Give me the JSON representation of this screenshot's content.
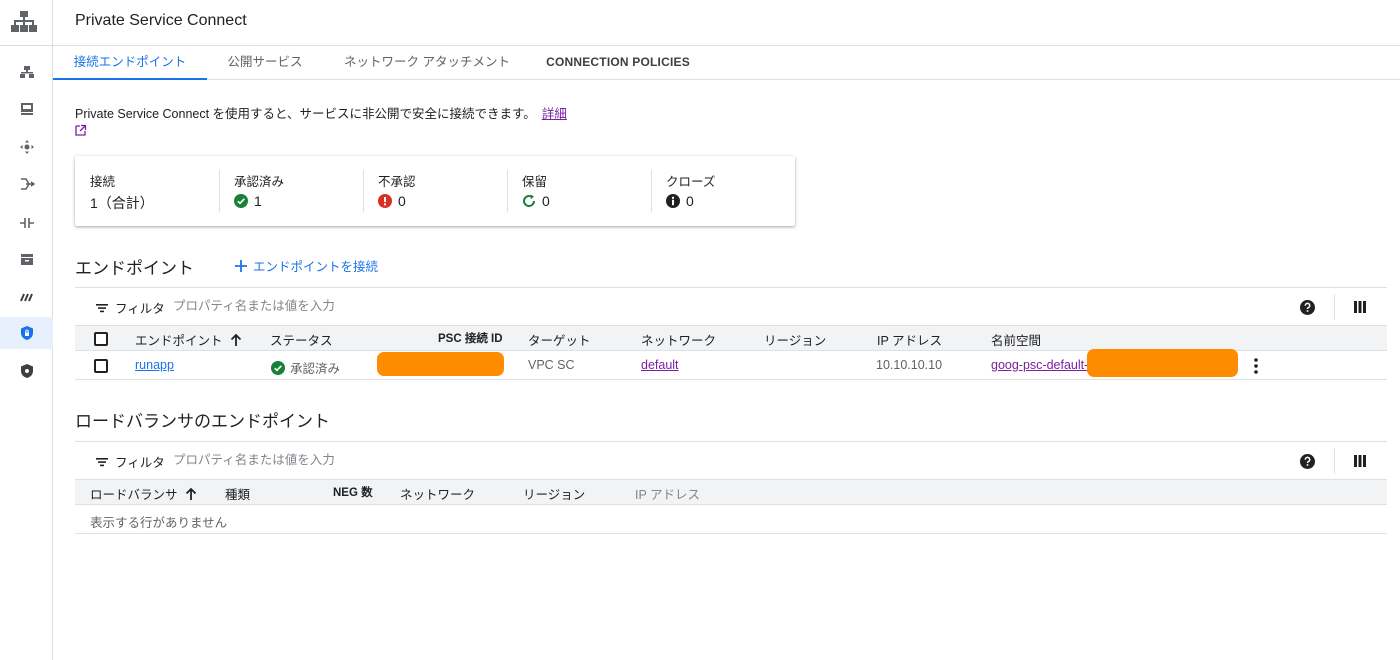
{
  "page": {
    "title": "Private Service Connect"
  },
  "rail": {
    "items": [
      {
        "icon": "network-topology-icon"
      },
      {
        "icon": "vm-instance-icon"
      },
      {
        "icon": "routes-icon"
      },
      {
        "icon": "load-balancing-icon"
      },
      {
        "icon": "interconnect-icon"
      },
      {
        "icon": "storage-icon"
      },
      {
        "icon": "network-services-icon"
      },
      {
        "icon": "private-service-connect-icon",
        "active": true
      },
      {
        "icon": "security-shield-icon"
      }
    ]
  },
  "tabs": [
    {
      "label": "接続エンドポイント",
      "active": true
    },
    {
      "label": "公開サービス"
    },
    {
      "label": "ネットワーク アタッチメント"
    },
    {
      "label": "CONNECTION POLICIES"
    }
  ],
  "description": {
    "text": "Private Service Connect を使用すると、サービスに非公開で安全に接続できます。",
    "link": "詳細"
  },
  "summary": [
    {
      "label": "接続",
      "value": "1（合計）",
      "icon": ""
    },
    {
      "label": "承認済み",
      "value": "1",
      "icon": "check-circle-icon",
      "color": "#188038"
    },
    {
      "label": "不承認",
      "value": "0",
      "icon": "error-icon",
      "color": "#d93025"
    },
    {
      "label": "保留",
      "value": "0",
      "icon": "pending-icon",
      "color": "#188038"
    },
    {
      "label": "クローズ",
      "value": "0",
      "icon": "info-icon",
      "color": "#202124"
    }
  ],
  "endpoints": {
    "title": "エンドポイント",
    "add_label": "エンドポイントを接続",
    "filter_label": "フィルタ",
    "filter_placeholder": "プロパティ名または値を入力",
    "columns": [
      "エンドポイント",
      "ステータス",
      "PSC 接続 ID",
      "ターゲット",
      "ネットワーク",
      "リージョン",
      "IP アドレス",
      "名前空間"
    ],
    "rows": [
      {
        "name": "runapp",
        "status": "承認済み",
        "psc_id": "",
        "target": "VPC SC",
        "network": "default",
        "region": "",
        "ip": "10.10.10.10",
        "namespace": "goog-psc-default-"
      }
    ]
  },
  "lb_endpoints": {
    "title": "ロードバランサのエンドポイント",
    "filter_label": "フィルタ",
    "filter_placeholder": "プロパティ名または値を入力",
    "columns": [
      "ロードバランサ",
      "種類",
      "NEG 数",
      "ネットワーク",
      "リージョン",
      "IP アドレス"
    ],
    "empty_text": "表示する行がありません"
  },
  "colors": {
    "accent": "#1a73e8",
    "link_purple": "#7b1fa2",
    "success": "#188038",
    "error": "#d93025",
    "redaction": "#ff8c00"
  }
}
